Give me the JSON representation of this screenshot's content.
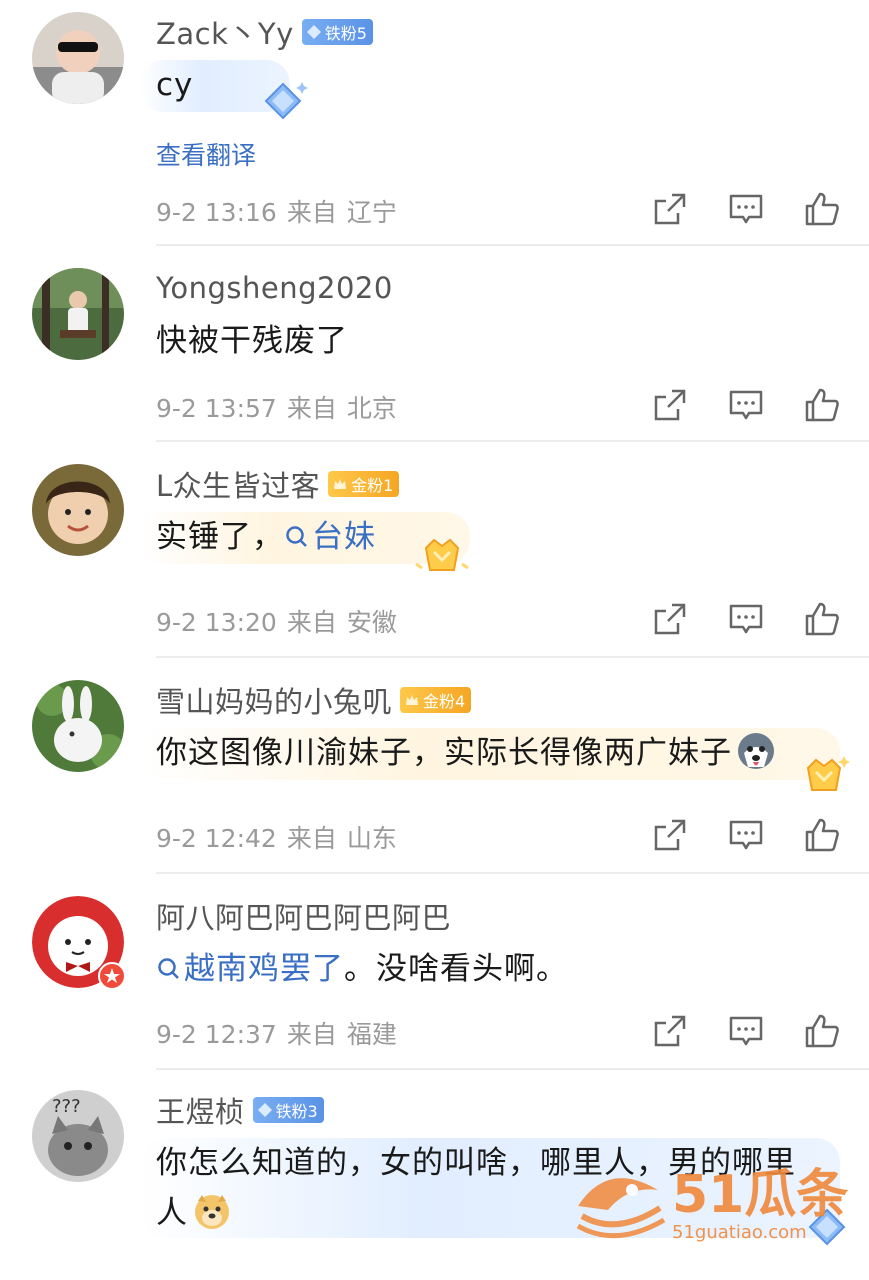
{
  "comments": [
    {
      "username": "Zack丶Yy",
      "badge": "铁粉5",
      "badge_type": "iron",
      "content": "cy",
      "translate_label": "查看翻译",
      "time": "9-2 13:16",
      "from_label": "来自",
      "location": "辽宁"
    },
    {
      "username": "Yongsheng2020",
      "content": "快被干残废了",
      "time": "9-2 13:57",
      "from_label": "来自",
      "location": "北京"
    },
    {
      "username": "L众生皆过客",
      "badge": "金粉1",
      "badge_type": "gold",
      "content": "实锤了，",
      "topic": "台妹",
      "time": "9-2 13:20",
      "from_label": "来自",
      "location": "安徽"
    },
    {
      "username": "雪山妈妈的小兔叽",
      "badge": "金粉4",
      "badge_type": "gold",
      "content": "你这图像川渝妹子，实际长得像两广妹子",
      "emoji": "husky-emoji",
      "time": "9-2 12:42",
      "from_label": "来自",
      "location": "山东"
    },
    {
      "username": "阿八阿巴阿巴阿巴阿巴",
      "topic": "越南鸡罢了",
      "content": "。没啥看头啊。",
      "time": "9-2 12:37",
      "from_label": "来自",
      "location": "福建"
    },
    {
      "username": "王煜桢",
      "badge": "铁粉3",
      "badge_type": "iron",
      "content": "你怎么知道的，女的叫啥，哪里人，男的哪里人",
      "emoji": "doge-emoji"
    }
  ],
  "icons": {
    "share": "share-icon",
    "reply": "comment-icon",
    "like": "thumbs-up-icon",
    "search": "search-icon"
  },
  "colors": {
    "link": "#3a6fc4",
    "meta": "#9a9a9a",
    "iron_badge": "#5a92e6",
    "gold_badge": "#f5a623",
    "watermark": "#f0883a"
  },
  "watermark": {
    "brand": "51瓜条",
    "url": "51guatiao.com"
  }
}
